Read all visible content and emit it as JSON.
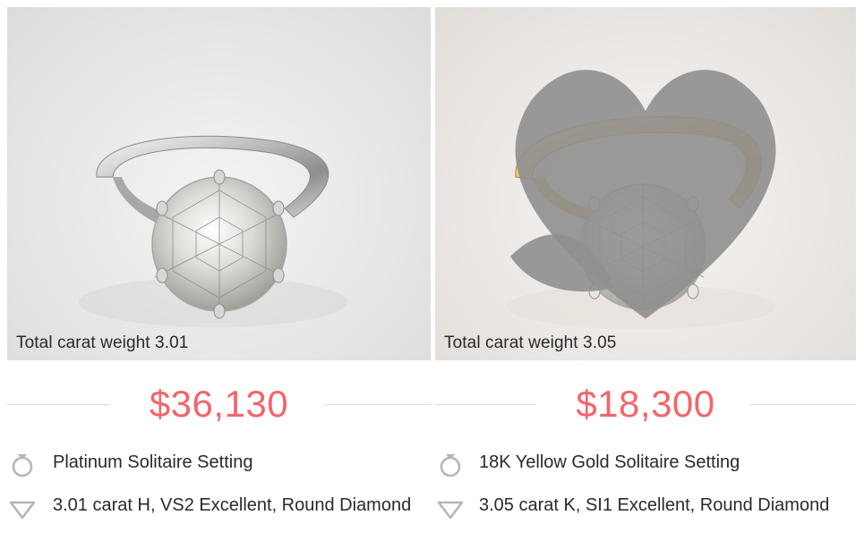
{
  "products": [
    {
      "carat_label": "Total carat weight 3.01",
      "price": "$36,130",
      "setting": "Platinum Solitaire Setting",
      "diamond": "3.01 carat H, VS2 Excellent, Round Diamond",
      "setting_icon": "ring-icon",
      "diamond_icon": "diamond-icon",
      "metal": "platinum"
    },
    {
      "carat_label": "Total carat weight 3.05",
      "price": "$18,300",
      "setting": "18K Yellow Gold Solitaire Setting",
      "diamond": "3.05 carat K, SI1 Excellent, Round Diamond",
      "setting_icon": "ring-icon",
      "diamond_icon": "diamond-icon",
      "metal": "yellow-gold"
    }
  ],
  "colors": {
    "price": "#f3656a",
    "divider": "#d9d9d9",
    "icon": "#b5b5b5",
    "favorite": "#8f8f8f"
  }
}
